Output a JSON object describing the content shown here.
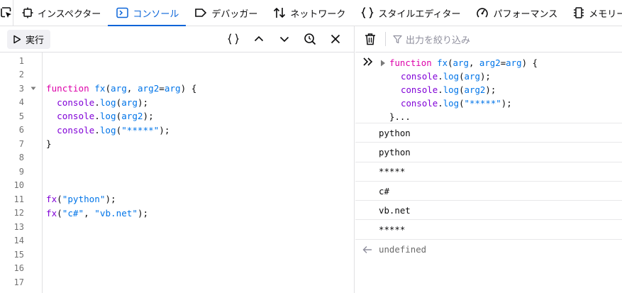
{
  "tabs": [
    {
      "label": "インスペクター",
      "icon": "inspector-icon",
      "active": false
    },
    {
      "label": "コンソール",
      "icon": "console-icon",
      "active": true
    },
    {
      "label": "デバッガー",
      "icon": "debugger-icon",
      "active": false
    },
    {
      "label": "ネットワーク",
      "icon": "network-icon",
      "active": false
    },
    {
      "label": "スタイルエディター",
      "icon": "style-editor-icon",
      "active": false
    },
    {
      "label": "パフォーマンス",
      "icon": "performance-icon",
      "active": false
    },
    {
      "label": "メモリー",
      "icon": "memory-icon",
      "active": false
    }
  ],
  "editor": {
    "run_label": "実行",
    "line_numbers": [
      "1",
      "2",
      "3",
      "4",
      "5",
      "6",
      "7",
      "8",
      "9",
      "10",
      "11",
      "12",
      "13",
      "14",
      "15",
      "16",
      "17"
    ],
    "code": {
      "l3": {
        "kw": "function",
        "name": "fx",
        "p1": "(",
        "a1": "arg",
        "c1": ", ",
        "a2": "arg2",
        "eq": "=",
        "a3": "arg",
        "p2": ") {"
      },
      "l4": {
        "obj": "console",
        "dot": ".",
        "m": "log",
        "p1": "(",
        "a": "arg",
        "p2": ");"
      },
      "l5": {
        "obj": "console",
        "dot": ".",
        "m": "log",
        "p1": "(",
        "a": "arg2",
        "p2": ");"
      },
      "l6": {
        "obj": "console",
        "dot": ".",
        "m": "log",
        "p1": "(",
        "s": "\"*****\"",
        "p2": ");"
      },
      "l7": "}",
      "l11": {
        "f": "fx",
        "p1": "(",
        "s": "\"python\"",
        "p2": ");"
      },
      "l12": {
        "f": "fx",
        "p1": "(",
        "s1": "\"c#\"",
        "c": ", ",
        "s2": "\"vb.net\"",
        "p2": ");"
      }
    }
  },
  "console": {
    "filter_placeholder": "出力を絞り込み",
    "command": {
      "l1": {
        "kw": "function",
        "name": "fx",
        "p1": "(",
        "a1": "arg",
        "c1": ", ",
        "a2": "arg2",
        "eq": "=",
        "a3": "arg",
        "p2": ") {"
      },
      "l2": {
        "obj": "console",
        "dot": ".",
        "m": "log",
        "p1": "(",
        "a": "arg",
        "p2": ");"
      },
      "l3": {
        "obj": "console",
        "dot": ".",
        "m": "log",
        "p1": "(",
        "a": "arg2",
        "p2": ");"
      },
      "l4": {
        "obj": "console",
        "dot": ".",
        "m": "log",
        "p1": "(",
        "s": "\"*****\"",
        "p2": ");"
      },
      "l5": "}..."
    },
    "messages": [
      "python",
      "python",
      "*****",
      "c#",
      "vb.net",
      "*****"
    ],
    "result": "undefined"
  },
  "colors": {
    "accent": "#0a64d8",
    "keyword": "#dd00a9",
    "function_name": "#0074e8",
    "string": "#0a7c0a",
    "console_obj": "#8000d7"
  }
}
